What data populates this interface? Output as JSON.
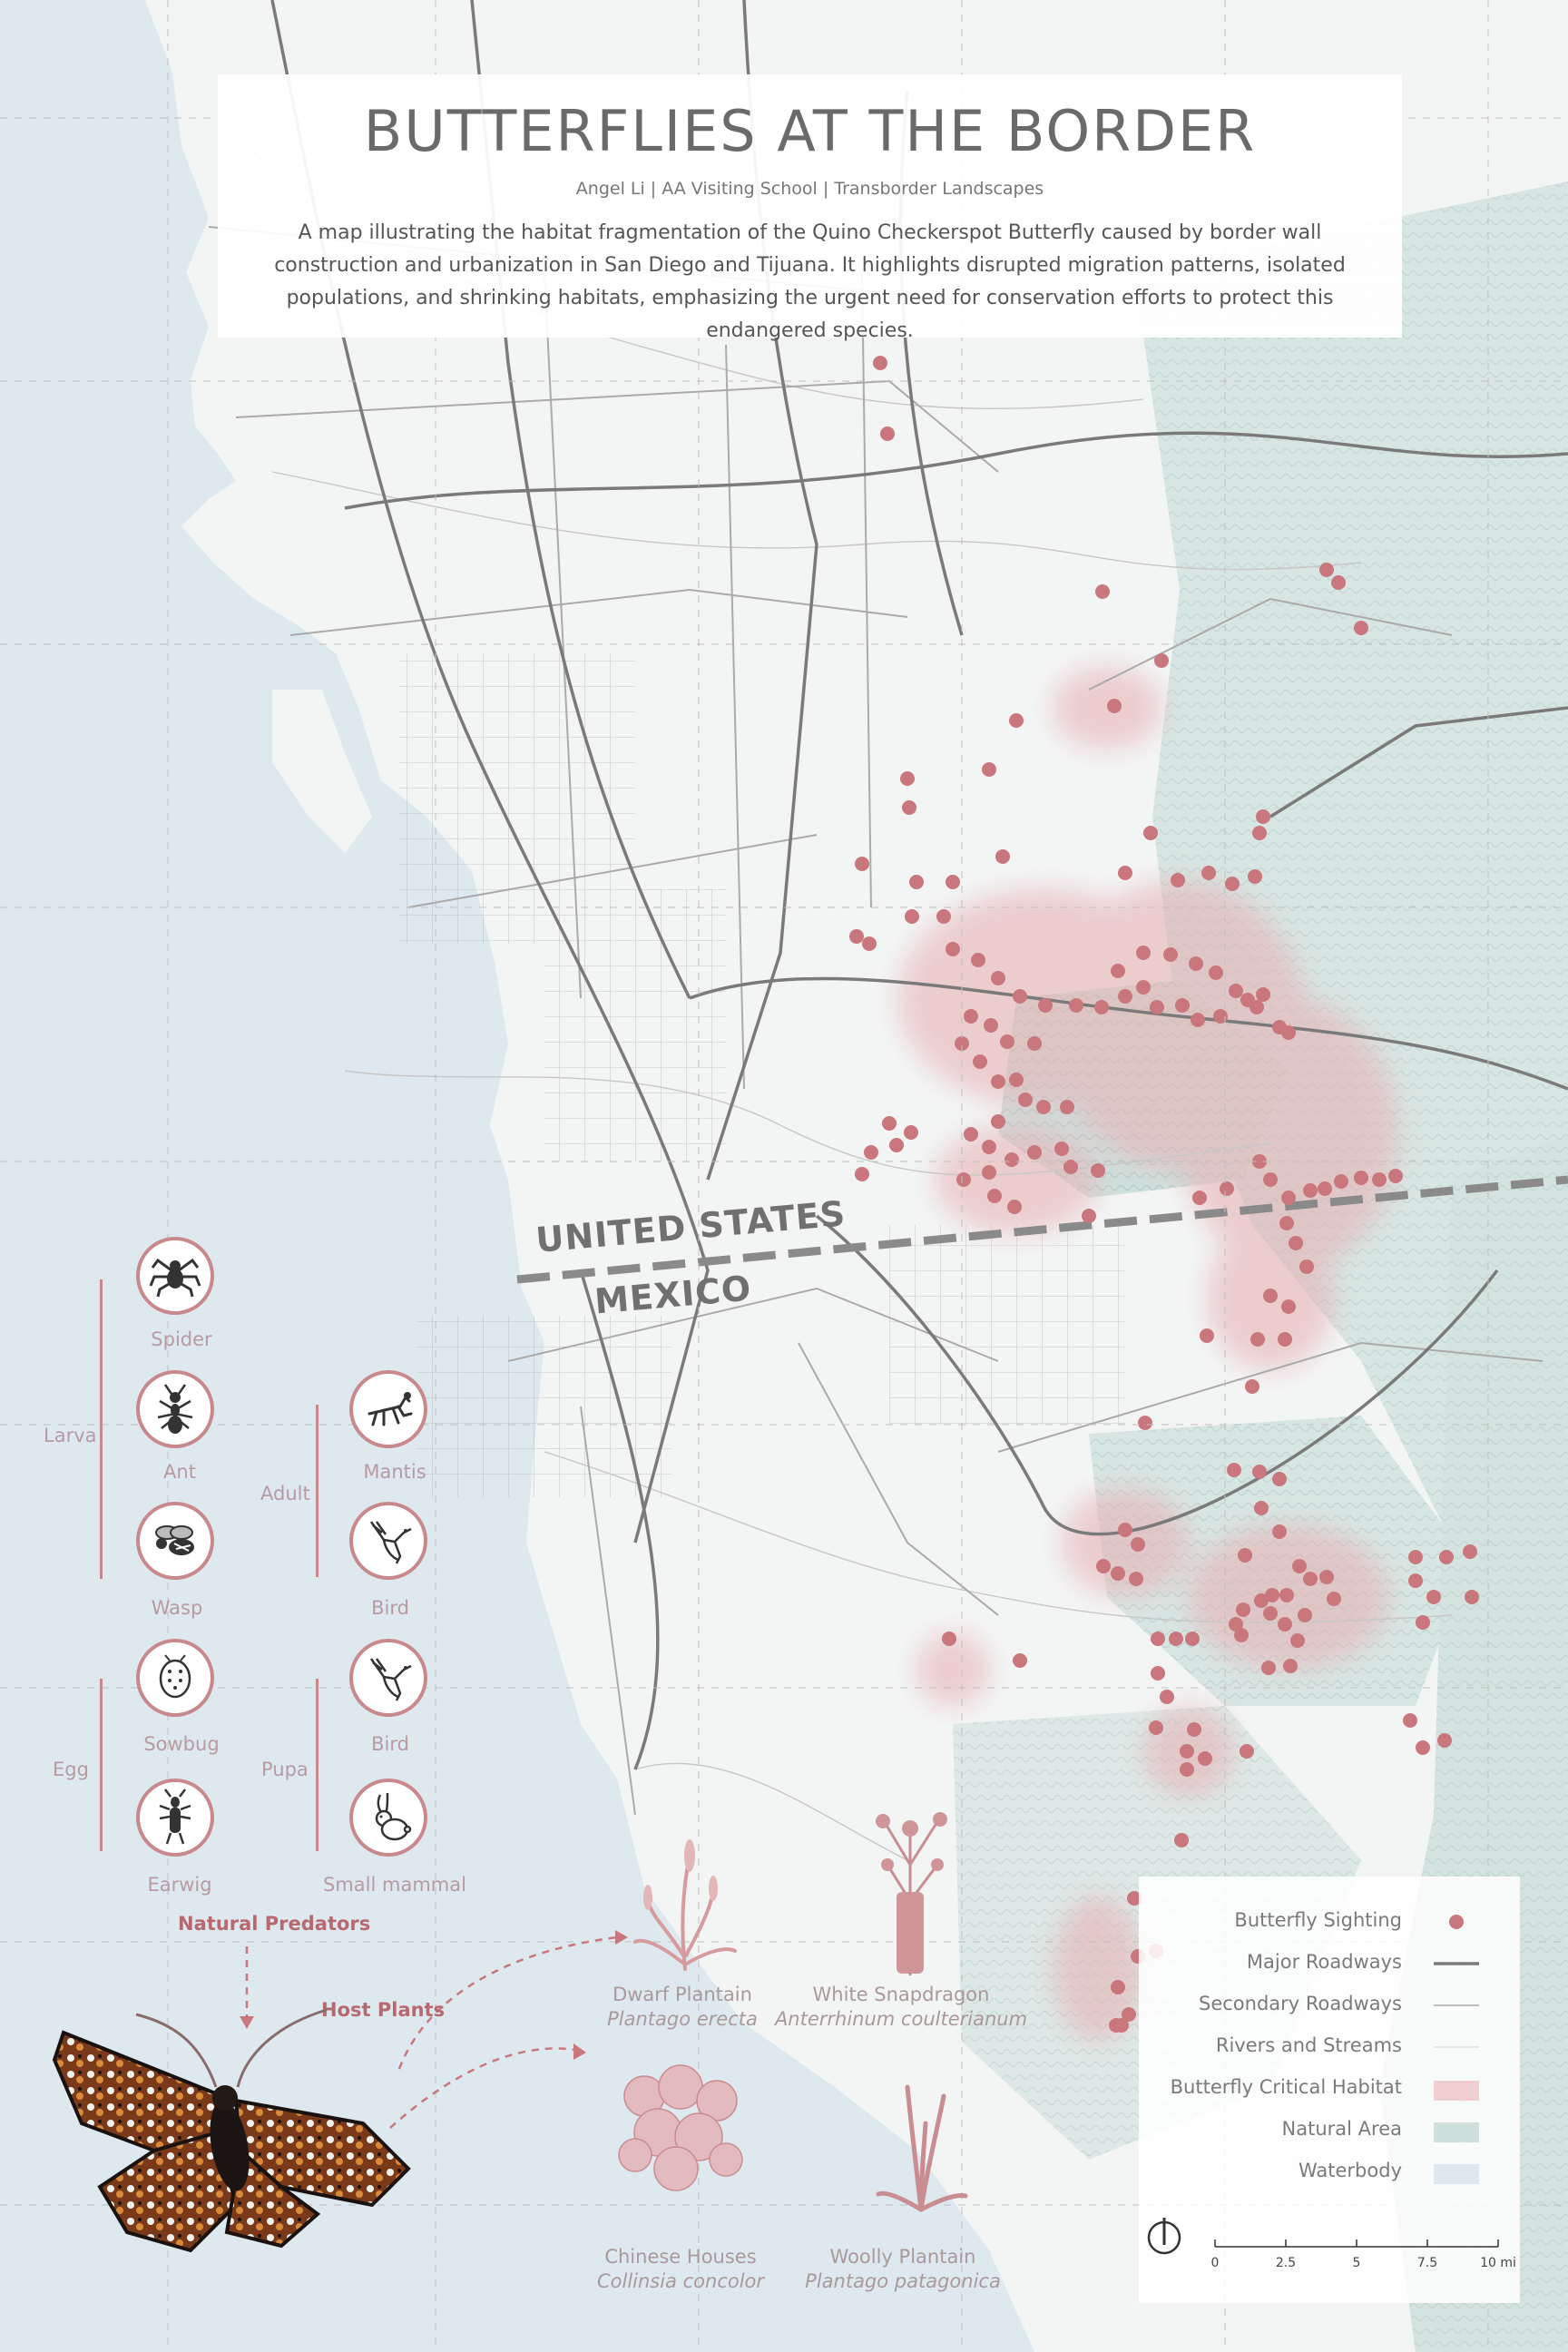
{
  "title": "BUTTERFLIES AT THE BORDER",
  "byline": "Angel Li | AA Visiting School | Transborder Landscapes",
  "description": "A map illustrating the habitat fragmentation of the Quino Checkerspot Butterfly caused by border wall construction and urbanization in San Diego and Tijuana. It highlights disrupted migration patterns, isolated populations, and shrinking habitats, emphasizing the urgent need for conservation efforts to protect this endangered species.",
  "map_labels": {
    "us": "UNITED STATES",
    "mexico": "MEXICO"
  },
  "colors": {
    "water": "#dde9ef",
    "land": "#f4f6f6",
    "hills": "#c9dcd8",
    "sighting": "#c9777c",
    "habitat": "#e9bcbe",
    "major_road": "#7d7d7d",
    "minor_road": "#b0b0b0",
    "border": "#8a8a8a"
  },
  "predators": {
    "heading": "Natural Predators",
    "larva": {
      "label": "Larva",
      "items": [
        {
          "name": "Spider",
          "icon": "spider-icon"
        },
        {
          "name": "Ant",
          "icon": "ant-icon"
        },
        {
          "name": "Wasp",
          "icon": "wasp-icon"
        }
      ]
    },
    "adult": {
      "label": "Adult",
      "items": [
        {
          "name": "Mantis",
          "icon": "mantis-icon"
        },
        {
          "name": "Bird",
          "icon": "bird-icon"
        }
      ]
    },
    "egg": {
      "label": "Egg",
      "items": [
        {
          "name": "Sowbug",
          "icon": "sowbug-icon"
        },
        {
          "name": "Earwig",
          "icon": "earwig-icon"
        }
      ]
    },
    "pupa": {
      "label": "Pupa",
      "items": [
        {
          "name": "Bird",
          "icon": "bird-icon"
        },
        {
          "name": "Small mammal",
          "icon": "rabbit-icon"
        }
      ]
    }
  },
  "host_plants": {
    "heading": "Host Plants",
    "items": [
      {
        "common": "Dwarf Plantain",
        "latin": "Plantago erecta"
      },
      {
        "common": "White Snapdragon",
        "latin": "Anterrhinum coulterianum"
      },
      {
        "common": "Chinese Houses",
        "latin": "Collinsia concolor"
      },
      {
        "common": "Woolly Plantain",
        "latin": "Plantago patagonica"
      }
    ]
  },
  "legend": {
    "items": [
      {
        "label": "Butterfly Sighting",
        "symbol": "dot"
      },
      {
        "label": "Major Roadways",
        "symbol": "thick-line"
      },
      {
        "label": "Secondary Roadways",
        "symbol": "thin-line"
      },
      {
        "label": "Rivers and Streams",
        "symbol": "faint-line"
      },
      {
        "label": "Butterfly Critical Habitat",
        "symbol": "pink-swatch"
      },
      {
        "label": "Natural Area",
        "symbol": "green-swatch"
      },
      {
        "label": "Waterbody",
        "symbol": "blue-swatch"
      }
    ],
    "scale": {
      "ticks": [
        "0",
        "2.5",
        "5",
        "7.5",
        "10 mi"
      ]
    }
  }
}
